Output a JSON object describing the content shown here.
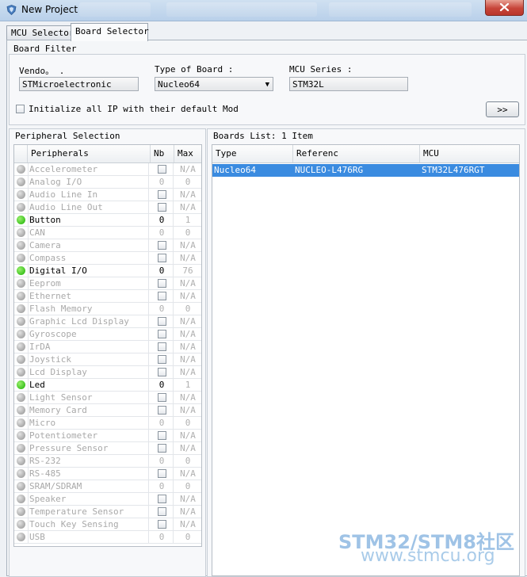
{
  "window": {
    "title": "New Project"
  },
  "tabs": [
    {
      "label": "MCU Selector"
    },
    {
      "label": "Board Selector"
    }
  ],
  "board_filter": {
    "title": "Board Filter",
    "vendor_label": "Vendo。 .",
    "vendor_value": "STMicroelectronic",
    "type_label": "Type of Board :",
    "type_value": "Nucleo64",
    "series_label": "MCU Series :",
    "series_value": "STM32L",
    "init_checkbox_label": "Initialize all IP with their default Mod",
    "more_button": ">>"
  },
  "peripheral_selection": {
    "title": "Peripheral Selection",
    "headers": {
      "name": "Peripherals",
      "nb": "Nb",
      "max": "Max"
    },
    "rows": [
      {
        "name": "Accelerometer",
        "nb": "",
        "max": "N/A",
        "active": false
      },
      {
        "name": "Analog I/O",
        "nb": "0",
        "max": "0",
        "active": false
      },
      {
        "name": "Audio Line In",
        "nb": "",
        "max": "N/A",
        "active": false
      },
      {
        "name": "Audio Line Out",
        "nb": "",
        "max": "N/A",
        "active": false
      },
      {
        "name": "Button",
        "nb": "0",
        "max": "1",
        "active": true
      },
      {
        "name": "CAN",
        "nb": "0",
        "max": "0",
        "active": false
      },
      {
        "name": "Camera",
        "nb": "",
        "max": "N/A",
        "active": false
      },
      {
        "name": "Compass",
        "nb": "",
        "max": "N/A",
        "active": false
      },
      {
        "name": "Digital I/O",
        "nb": "0",
        "max": "76",
        "active": true
      },
      {
        "name": "Eeprom",
        "nb": "",
        "max": "N/A",
        "active": false
      },
      {
        "name": "Ethernet",
        "nb": "",
        "max": "N/A",
        "active": false
      },
      {
        "name": "Flash Memory",
        "nb": "0",
        "max": "0",
        "active": false
      },
      {
        "name": "Graphic Lcd Display",
        "nb": "",
        "max": "N/A",
        "active": false
      },
      {
        "name": "Gyroscope",
        "nb": "",
        "max": "N/A",
        "active": false
      },
      {
        "name": "IrDA",
        "nb": "",
        "max": "N/A",
        "active": false
      },
      {
        "name": "Joystick",
        "nb": "",
        "max": "N/A",
        "active": false
      },
      {
        "name": "Lcd Display",
        "nb": "",
        "max": "N/A",
        "active": false
      },
      {
        "name": "Led",
        "nb": "0",
        "max": "1",
        "active": true
      },
      {
        "name": "Light Sensor",
        "nb": "",
        "max": "N/A",
        "active": false
      },
      {
        "name": "Memory Card",
        "nb": "",
        "max": "N/A",
        "active": false
      },
      {
        "name": "Micro",
        "nb": "0",
        "max": "0",
        "active": false
      },
      {
        "name": "Potentiometer",
        "nb": "",
        "max": "N/A",
        "active": false
      },
      {
        "name": "Pressure Sensor",
        "nb": "",
        "max": "N/A",
        "active": false
      },
      {
        "name": "RS-232",
        "nb": "0",
        "max": "0",
        "active": false
      },
      {
        "name": "RS-485",
        "nb": "",
        "max": "N/A",
        "active": false
      },
      {
        "name": "SRAM/SDRAM",
        "nb": "0",
        "max": "0",
        "active": false
      },
      {
        "name": "Speaker",
        "nb": "",
        "max": "N/A",
        "active": false
      },
      {
        "name": "Temperature Sensor",
        "nb": "",
        "max": "N/A",
        "active": false
      },
      {
        "name": "Touch Key Sensing",
        "nb": "",
        "max": "N/A",
        "active": false
      },
      {
        "name": "USB",
        "nb": "0",
        "max": "0",
        "active": false
      }
    ]
  },
  "boards_list": {
    "title": "Boards List: 1 Item",
    "headers": {
      "type": "Type",
      "reference": "Referenc",
      "mcu": "MCU"
    },
    "rows": [
      {
        "type": "Nucleo64",
        "reference": "NUCLEO-L476RG",
        "mcu": "STM32L476RGT"
      }
    ]
  },
  "watermark": {
    "line1": "STM32/STM8社区",
    "line2": "www.stmcu.org"
  },
  "colors": {
    "selection": "#3a8be0",
    "active_dot": "#18b000",
    "inactive_text": "#a9a9a9"
  }
}
